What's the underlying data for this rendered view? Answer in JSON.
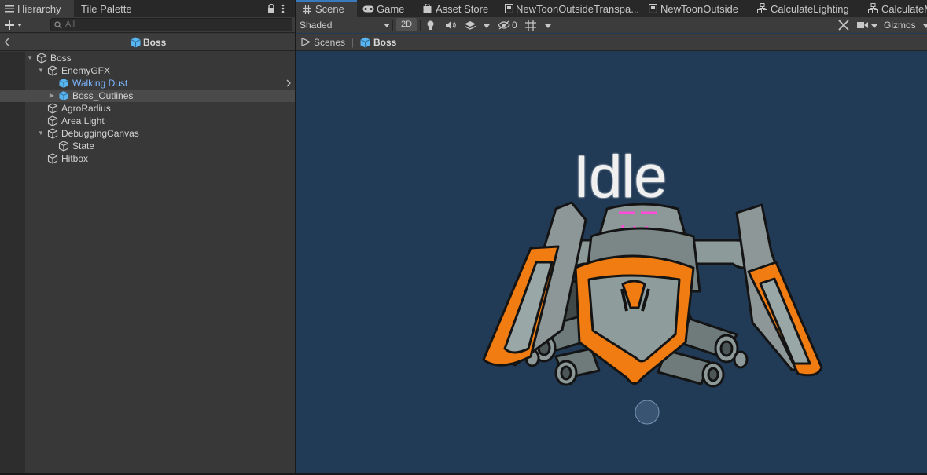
{
  "hierarchy_window": {
    "tabs": [
      "Hierarchy",
      "Tile Palette"
    ],
    "search_placeholder": "All",
    "breadcrumb_title": "Boss",
    "items": [
      {
        "label": "Boss",
        "depth": 0,
        "expanded": true
      },
      {
        "label": "EnemyGFX",
        "depth": 1,
        "expanded": true
      },
      {
        "label": "Walking Dust",
        "depth": 2,
        "prefab": true
      },
      {
        "label": "Boss_Outlines",
        "depth": 2,
        "prefab": true,
        "collapsed": true,
        "selected": true
      },
      {
        "label": "AgroRadius",
        "depth": 1
      },
      {
        "label": "Area Light",
        "depth": 1
      },
      {
        "label": "DebuggingCanvas",
        "depth": 1,
        "expanded": true
      },
      {
        "label": "State",
        "depth": 2
      },
      {
        "label": "Hitbox",
        "depth": 1
      }
    ]
  },
  "scene_window": {
    "tabs": [
      "Scene",
      "Game",
      "Asset Store",
      "NewToonOutsideTranspa...",
      "NewToonOutside",
      "CalculateLighting",
      "CalculateM"
    ],
    "active_tab": "Scene",
    "shading_mode": "Shaded",
    "mode_2d": "2D",
    "hidden_count": "0",
    "gizmos_label": "Gizmos",
    "breadcrumb": [
      "Scenes",
      "Boss"
    ],
    "state_label": "Idle"
  },
  "colors": {
    "scene_background": "#213a56",
    "accent_tab": "#3a79bb",
    "prefab_blue": "#7db6ff",
    "boss_orange": "#f07c12",
    "boss_grey": "#8a9595"
  }
}
